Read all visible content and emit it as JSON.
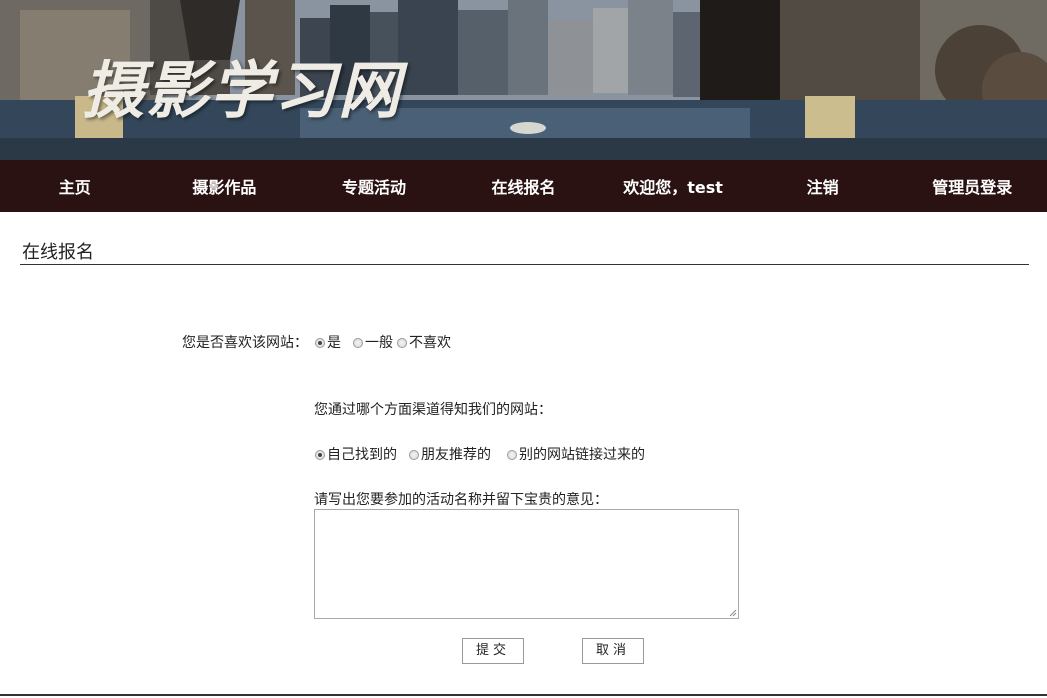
{
  "banner": {
    "site_title": "摄影学习网"
  },
  "nav": {
    "items": [
      {
        "label": "主页"
      },
      {
        "label": "摄影作品"
      },
      {
        "label": "专题活动"
      },
      {
        "label": "在线报名"
      },
      {
        "label": "欢迎您，test"
      },
      {
        "label": "注销"
      },
      {
        "label": "管理员登录"
      }
    ],
    "background_color": "#2a1212"
  },
  "section": {
    "title": "在线报名"
  },
  "form": {
    "q1": {
      "label": "您是否喜欢该网站：",
      "options": [
        {
          "label": "是",
          "checked": true
        },
        {
          "label": "一般",
          "checked": false
        },
        {
          "label": "不喜欢",
          "checked": false
        }
      ]
    },
    "q2": {
      "label": "您通过哪个方面渠道得知我们的网站：",
      "options": [
        {
          "label": "自己找到的",
          "checked": true
        },
        {
          "label": "朋友推荐的",
          "checked": false
        },
        {
          "label": "别的网站链接过来的",
          "checked": false
        }
      ]
    },
    "q3": {
      "label": "请写出您要参加的活动名称并留下宝贵的意见：",
      "value": ""
    },
    "submit_label": "提交",
    "cancel_label": "取消"
  }
}
